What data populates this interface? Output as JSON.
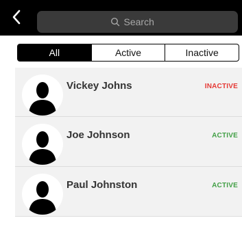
{
  "search": {
    "placeholder": "Search"
  },
  "filters": [
    {
      "label": "All",
      "selected": true
    },
    {
      "label": "Active",
      "selected": false
    },
    {
      "label": "Inactive",
      "selected": false
    }
  ],
  "contacts": [
    {
      "name": "Vickey Johns",
      "status": "INACTIVE",
      "status_color": "#e53935"
    },
    {
      "name": "Joe Johnson",
      "status": "ACTIVE",
      "status_color": "#43a047"
    },
    {
      "name": "Paul Johnston",
      "status": "ACTIVE",
      "status_color": "#43a047"
    }
  ],
  "colors": {
    "header_bg": "#000000",
    "search_bg": "#3a3a3a",
    "row_bg": "#f2f2f2"
  }
}
